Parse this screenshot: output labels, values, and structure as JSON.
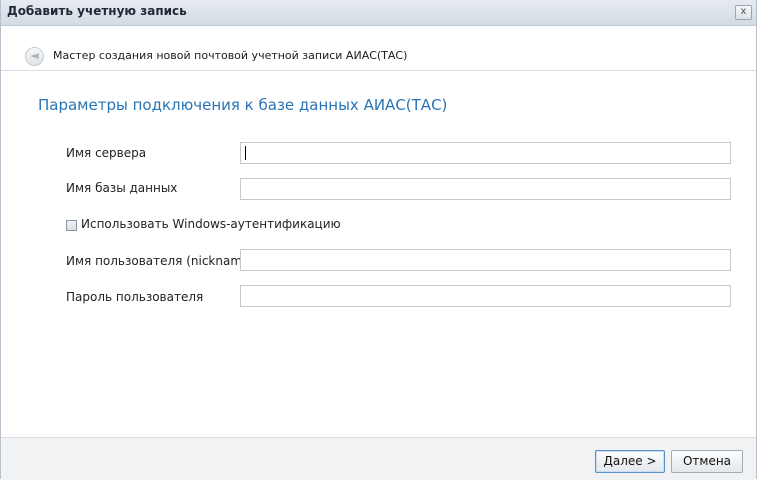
{
  "window": {
    "title": "Добавить учетную запись",
    "close_label": "x"
  },
  "wizard": {
    "back_icon": "◄",
    "header": "Мастер создания новой почтовой учетной записи АИАС(ТАС)"
  },
  "section": {
    "title": "Параметры подключения к базе данных АИАС(ТАС)"
  },
  "form": {
    "server_label": "Имя сервера",
    "server_value": "",
    "database_label": "Имя базы данных",
    "database_value": "",
    "windows_auth_label": "Использовать Windows-аутентификацию",
    "windows_auth_checked": false,
    "username_label": "Имя пользователя (nickname)",
    "username_value": "",
    "password_label": "Пароль пользователя",
    "password_value": ""
  },
  "buttons": {
    "next": "Далее >",
    "cancel": "Отмена"
  }
}
